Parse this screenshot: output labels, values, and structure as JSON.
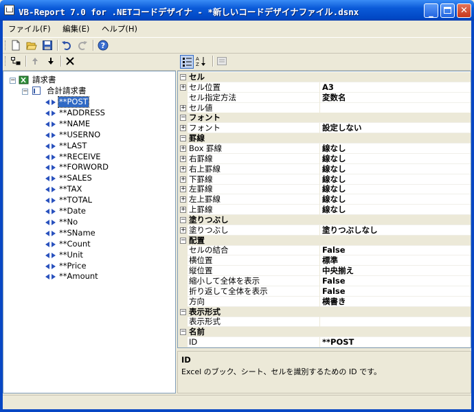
{
  "window": {
    "title": "VB-Report 7.0 for .NETコードデザイナ - *新しいコードデザイナファイル.dsnx"
  },
  "menu": [
    {
      "label": "ファイル(F)"
    },
    {
      "label": "編集(E)"
    },
    {
      "label": "ヘルプ(H)"
    }
  ],
  "toolbar": {
    "icons": [
      "new-file-icon",
      "open-folder-icon",
      "save-icon",
      "undo-icon",
      "redo-icon",
      "help-icon"
    ]
  },
  "tree": {
    "root": "請求書",
    "child": "合計請求書",
    "selected": "**POST",
    "fields": [
      "**POST",
      "**ADDRESS",
      "**NAME",
      "**USERNO",
      "**LAST",
      "**RECEIVE",
      "**FORWORD",
      "**SALES",
      "**TAX",
      "**TOTAL",
      "**Date",
      "**No",
      "**SName",
      "**Count",
      "**Unit",
      "**Price",
      "**Amount"
    ]
  },
  "properties": [
    {
      "type": "cat",
      "name": "セル"
    },
    {
      "type": "prop",
      "expand": true,
      "name": "セル位置",
      "value": "A3"
    },
    {
      "type": "prop",
      "expand": false,
      "name": "セル指定方法",
      "value": "変数名"
    },
    {
      "type": "prop",
      "expand": true,
      "name": "セル値",
      "value": ""
    },
    {
      "type": "cat",
      "name": "フォント"
    },
    {
      "type": "prop",
      "expand": true,
      "name": "フォント",
      "value": "設定しない"
    },
    {
      "type": "cat",
      "name": "罫線"
    },
    {
      "type": "prop",
      "expand": true,
      "name": "Box 罫線",
      "value": "線なし"
    },
    {
      "type": "prop",
      "expand": true,
      "name": "右罫線",
      "value": "線なし"
    },
    {
      "type": "prop",
      "expand": true,
      "name": "右上罫線",
      "value": "線なし"
    },
    {
      "type": "prop",
      "expand": true,
      "name": "下罫線",
      "value": "線なし"
    },
    {
      "type": "prop",
      "expand": true,
      "name": "左罫線",
      "value": "線なし"
    },
    {
      "type": "prop",
      "expand": true,
      "name": "左上罫線",
      "value": "線なし"
    },
    {
      "type": "prop",
      "expand": true,
      "name": "上罫線",
      "value": "線なし"
    },
    {
      "type": "cat",
      "name": "塗りつぶし"
    },
    {
      "type": "prop",
      "expand": true,
      "name": "塗りつぶし",
      "value": "塗りつぶしなし"
    },
    {
      "type": "cat",
      "name": "配置"
    },
    {
      "type": "prop",
      "expand": false,
      "name": "セルの結合",
      "value": "False"
    },
    {
      "type": "prop",
      "expand": false,
      "name": "横位置",
      "value": "標準"
    },
    {
      "type": "prop",
      "expand": false,
      "name": "縦位置",
      "value": "中央揃え"
    },
    {
      "type": "prop",
      "expand": false,
      "name": "縮小して全体を表示",
      "value": "False"
    },
    {
      "type": "prop",
      "expand": false,
      "name": "折り返して全体を表示",
      "value": "False"
    },
    {
      "type": "prop",
      "expand": false,
      "name": "方向",
      "value": "横書き"
    },
    {
      "type": "cat",
      "name": "表示形式"
    },
    {
      "type": "prop",
      "expand": false,
      "name": "表示形式",
      "value": ""
    },
    {
      "type": "cat",
      "name": "名前"
    },
    {
      "type": "prop",
      "expand": false,
      "name": "ID",
      "value": "**POST"
    }
  ],
  "description": {
    "heading": "ID",
    "text": "Excel のブック、シート、セルを識別するための ID です。"
  }
}
